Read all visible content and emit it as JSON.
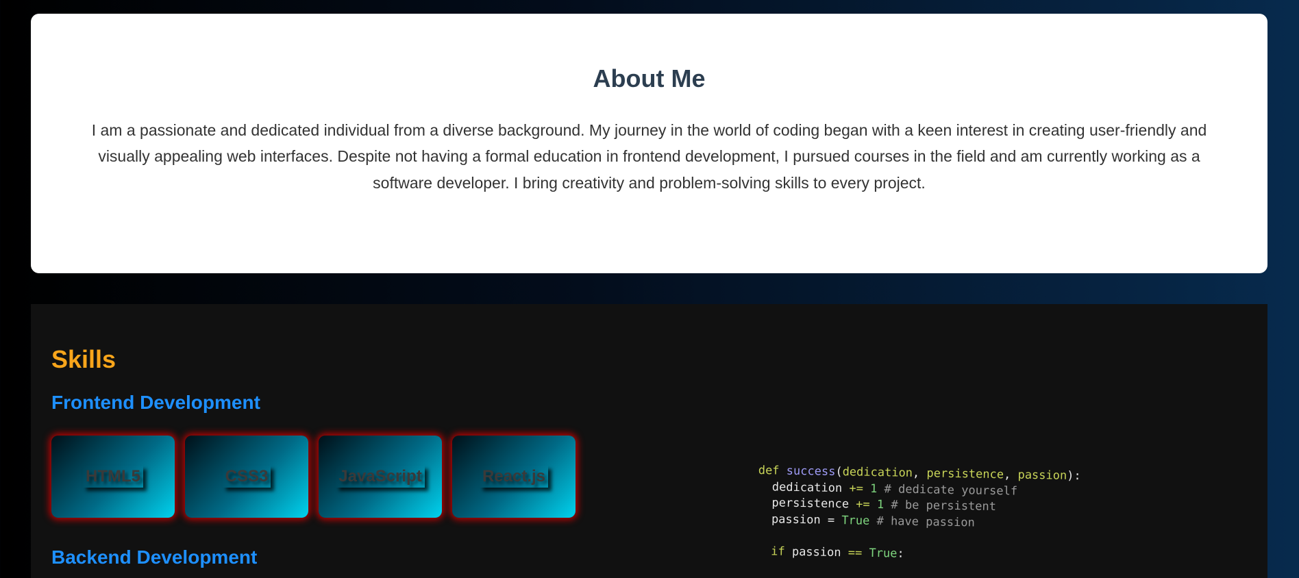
{
  "about": {
    "title": "About Me",
    "text": "I am a passionate and dedicated individual from a diverse background. My journey in the world of coding began with a keen interest in creating user-friendly and visually appealing web interfaces. Despite not having a formal education in frontend development, I pursued courses in the field and am currently working as a software developer. I bring creativity and problem-solving skills to every project."
  },
  "skills": {
    "title": "Skills",
    "frontend_title": "Frontend Development",
    "frontend_items": [
      "HTML5",
      "CSS3",
      "JavaScript",
      "React.js"
    ],
    "backend_title": "Backend Development"
  },
  "code": {
    "line1": {
      "def": "def",
      "name": "success",
      "open": "(",
      "p1": "dedication",
      "c1": ", ",
      "p2": "persistence",
      "c2": ", ",
      "p3": "passion",
      "close": "):"
    },
    "line2": {
      "var": "  dedication ",
      "op": "+=",
      "num": " 1",
      "comment": " # dedicate yourself"
    },
    "line3": {
      "var": "  persistence ",
      "op": "+=",
      "num": " 1",
      "comment": " # be persistent"
    },
    "line4": {
      "var": "  passion = ",
      "val": "True",
      "comment": " # have passion"
    },
    "line6": {
      "kw": "  if",
      "var": " passion ",
      "op": "==",
      "val": " True",
      "end": ":"
    }
  },
  "colors": {
    "skills_title": "#f8a51b",
    "category_title": "#1e90ff",
    "card_glow": "#dc0000"
  }
}
